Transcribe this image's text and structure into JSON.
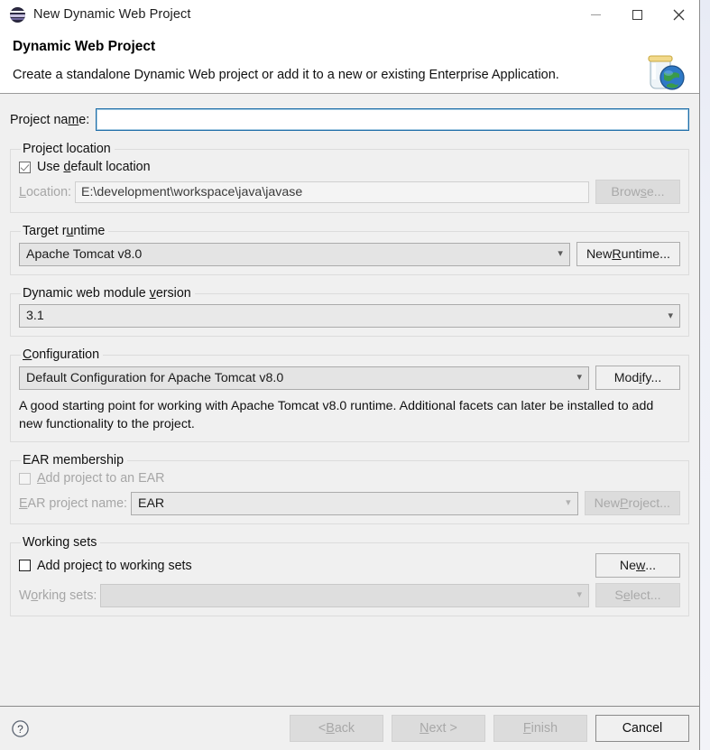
{
  "window": {
    "title": "New Dynamic Web Project",
    "app_icon": "eclipse-icon",
    "minimize_label": "Minimize",
    "maximize_label": "Maximize",
    "close_label": "Close"
  },
  "banner": {
    "heading": "Dynamic Web Project",
    "description": "Create a standalone Dynamic Web project or add it to a new or existing Enterprise Application.",
    "icon": "web-project-jar-globe-icon"
  },
  "project_name": {
    "label_pre": "Project na",
    "label_mnemonic": "m",
    "label_post": "e:",
    "value": "",
    "placeholder": ""
  },
  "project_location": {
    "legend": "Project location",
    "use_default": {
      "label_pre": "Use ",
      "label_mnemonic": "d",
      "label_post": "efault location",
      "checked": true
    },
    "location": {
      "label_mnemonic": "L",
      "label_post": "ocation:",
      "value": "E:\\development\\workspace\\java\\javase"
    },
    "browse_button": {
      "label_pre": "Brow",
      "label_mnemonic": "s",
      "label_post": "e...",
      "enabled": false
    }
  },
  "target_runtime": {
    "legend_pre": "Target r",
    "legend_mnemonic": "u",
    "legend_post": "ntime",
    "selected": "Apache Tomcat v8.0",
    "new_runtime_button": {
      "label_pre": "New ",
      "label_mnemonic": "R",
      "label_post": "untime...",
      "enabled": true
    }
  },
  "module_version": {
    "legend_pre": "Dynamic web module ",
    "legend_mnemonic": "v",
    "legend_post": "ersion",
    "selected": "3.1"
  },
  "configuration": {
    "legend_mnemonic": "C",
    "legend_post": "onfiguration",
    "selected": "Default Configuration for Apache Tomcat v8.0",
    "modify_button": {
      "label_pre": "Mod",
      "label_mnemonic": "i",
      "label_post": "fy...",
      "enabled": true
    },
    "description": "A good starting point for working with Apache Tomcat v8.0 runtime. Additional facets can later be installed to add new functionality to the project."
  },
  "ear_membership": {
    "legend": "EAR membership",
    "add_to_ear": {
      "label_mnemonic": "A",
      "label_post": "dd project to an EAR",
      "checked": false,
      "enabled": false
    },
    "ear_project_name": {
      "label_mnemonic": "E",
      "label_post": "AR project name:",
      "value": "EAR",
      "enabled": false
    },
    "new_project_button": {
      "label_pre": "New ",
      "label_mnemonic": "P",
      "label_post": "roject...",
      "enabled": false
    }
  },
  "working_sets": {
    "legend": "Working sets",
    "add_to_working_sets": {
      "label_pre": "Add projec",
      "label_mnemonic": "t",
      "label_post": " to working sets",
      "checked": false,
      "enabled": true
    },
    "new_button": {
      "label_pre": "Ne",
      "label_mnemonic": "w",
      "label_post": "...",
      "enabled": true
    },
    "working_sets_field": {
      "label_pre": "W",
      "label_mnemonic": "o",
      "label_post": "rking sets:",
      "value": "",
      "enabled": false
    },
    "select_button": {
      "label_pre": "S",
      "label_mnemonic": "e",
      "label_post": "lect...",
      "enabled": false
    }
  },
  "footer": {
    "help_icon": "help-question-icon",
    "back_button": {
      "label_pre": "< ",
      "label_mnemonic": "B",
      "label_post": "ack",
      "enabled": false
    },
    "next_button": {
      "label_mnemonic": "N",
      "label_post": "ext >",
      "enabled": false
    },
    "finish_button": {
      "label_mnemonic": "F",
      "label_post": "inish",
      "enabled": false
    },
    "cancel_button": {
      "label": "Cancel",
      "enabled": true
    }
  },
  "colors": {
    "dialog_bg": "#f0f0f0",
    "banner_bg": "#ffffff",
    "focus_border": "#1f6ea8",
    "disabled_text": "#a8a8a8"
  }
}
